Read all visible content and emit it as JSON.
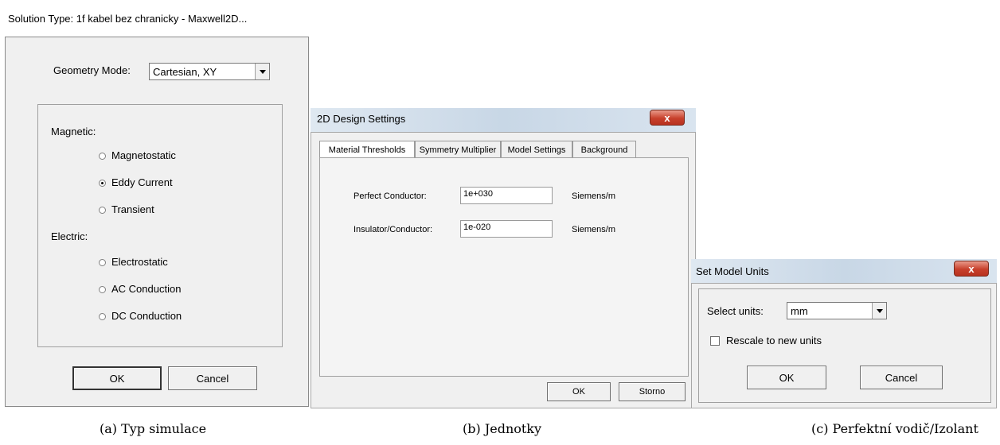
{
  "dialog_a": {
    "title": "Solution Type: 1f kabel bez chranicky - Maxwell2D...",
    "geometry_mode_label": "Geometry Mode:",
    "geometry_mode_value": "Cartesian, XY",
    "magnetic_label": "Magnetic:",
    "electric_label": "Electric:",
    "options": [
      {
        "label": "Magnetostatic",
        "checked": false
      },
      {
        "label": "Eddy Current",
        "checked": true
      },
      {
        "label": "Transient",
        "checked": false
      },
      {
        "label": "Electrostatic",
        "checked": false
      },
      {
        "label": "AC Conduction",
        "checked": false
      },
      {
        "label": "DC Conduction",
        "checked": false
      }
    ],
    "ok": "OK",
    "cancel": "Cancel"
  },
  "dialog_b": {
    "title": "2D Design Settings",
    "close": "x",
    "tabs": [
      "Material Thresholds",
      "Symmetry Multiplier",
      "Model Settings",
      "Background"
    ],
    "perfect_conductor_label": "Perfect Conductor:",
    "perfect_conductor_value": "1e+030",
    "perfect_conductor_unit": "Siemens/m",
    "insulator_label": "Insulator/Conductor:",
    "insulator_value": "1e-020",
    "insulator_unit": "Siemens/m",
    "ok": "OK",
    "storno": "Storno"
  },
  "dialog_c": {
    "title": "Set Model Units",
    "close": "x",
    "select_units_label": "Select units:",
    "select_units_value": "mm",
    "rescale_label": "Rescale to new units",
    "rescale_checked": false,
    "ok": "OK",
    "cancel": "Cancel"
  },
  "captions": {
    "a": "(a) Typ simulace",
    "b": "(b) Jednotky",
    "c": "(c) Perfektní vodič/Izolant"
  }
}
